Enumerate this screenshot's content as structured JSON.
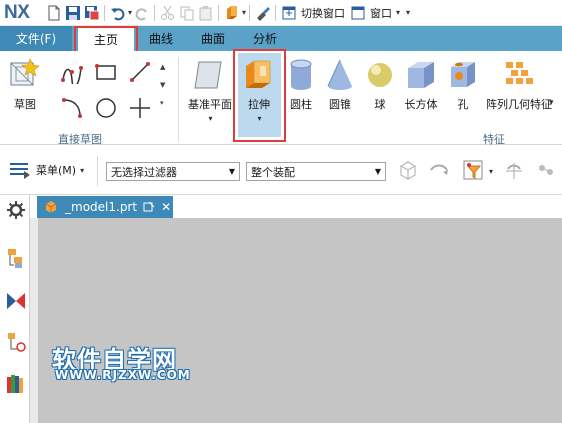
{
  "app": {
    "logo": "NX"
  },
  "quick_access": {
    "switch_window_label": "切换窗口",
    "window_menu_label": "窗口"
  },
  "tabs": {
    "file": "文件(F)",
    "home": "主页",
    "curve": "曲线",
    "surface": "曲面",
    "analysis": "分析"
  },
  "ribbon": {
    "sketch_label": "草图",
    "direct_sketch_group": "直接草图",
    "datum_plane_label": "基准平面",
    "extrude_label": "拉伸",
    "cylinder_label": "圆柱",
    "cone_label": "圆锥",
    "sphere_label": "球",
    "block_label": "长方体",
    "hole_label": "孔",
    "pattern_label": "阵列几何特征",
    "feature_group": "特征"
  },
  "toolbar2": {
    "menu_label": "菜单(M)",
    "filter_value": "无选择过滤器",
    "scope_value": "整个装配"
  },
  "document": {
    "tab_name": "_model1.prt"
  },
  "watermark": {
    "title": "软件自学网",
    "url": "WWW.RJZXW.COM"
  },
  "colors": {
    "tab_bar": "#5aa2c8",
    "file_tab": "#3f89b6",
    "highlight_red": "#e23b3b",
    "canvas": "#c5c5c5"
  }
}
